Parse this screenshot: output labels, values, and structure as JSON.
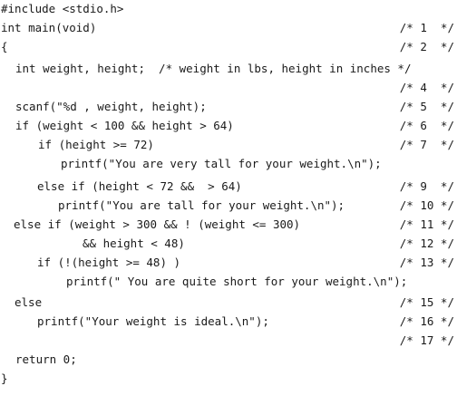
{
  "code": {
    "l1": {
      "code": "#include <stdio.h>",
      "comment": ""
    },
    "l2": {
      "code": "int main(void)",
      "comment": "/* 1  */"
    },
    "l3": {
      "code": "{",
      "comment": "/* 2  */"
    },
    "l4": {
      "code": "int weight, height;  /* weight in lbs, height in inches */",
      "comment": ""
    },
    "l5": {
      "code": "",
      "comment": "/* 4  */"
    },
    "l6": {
      "code": "scanf(\"%d , weight, height);",
      "comment": "/* 5  */"
    },
    "l7": {
      "code": "if (weight < 100 && height > 64)",
      "comment": "/* 6  */"
    },
    "l8": {
      "code": "if (height >= 72)",
      "comment": "/* 7  */"
    },
    "l9": {
      "code": "printf(\"You are very tall for your weight.\\n\");",
      "comment": ""
    },
    "l10": {
      "code": "else if (height < 72 &&  > 64)",
      "comment": "/* 9  */"
    },
    "l11": {
      "code": "printf(\"You are tall for your weight.\\n\");",
      "comment": "/* 10 */"
    },
    "l12": {
      "code": "else if (weight > 300 && ! (weight <= 300)",
      "comment": "/* 11 */"
    },
    "l13": {
      "code": "&& height < 48)",
      "comment": "/* 12 */"
    },
    "l14": {
      "code": "if (!(height >= 48) )",
      "comment": "/* 13 */"
    },
    "l15": {
      "code": "printf(\" You are quite short for your weight.\\n\");",
      "comment": ""
    },
    "l16": {
      "code": "else",
      "comment": "/* 15 */"
    },
    "l17": {
      "code": "printf(\"Your weight is ideal.\\n\");",
      "comment": "/* 16 */"
    },
    "l18": {
      "code": "",
      "comment": "/* 17 */"
    },
    "l19": {
      "code": "return 0;",
      "comment": ""
    },
    "l20": {
      "code": "}",
      "comment": ""
    }
  }
}
